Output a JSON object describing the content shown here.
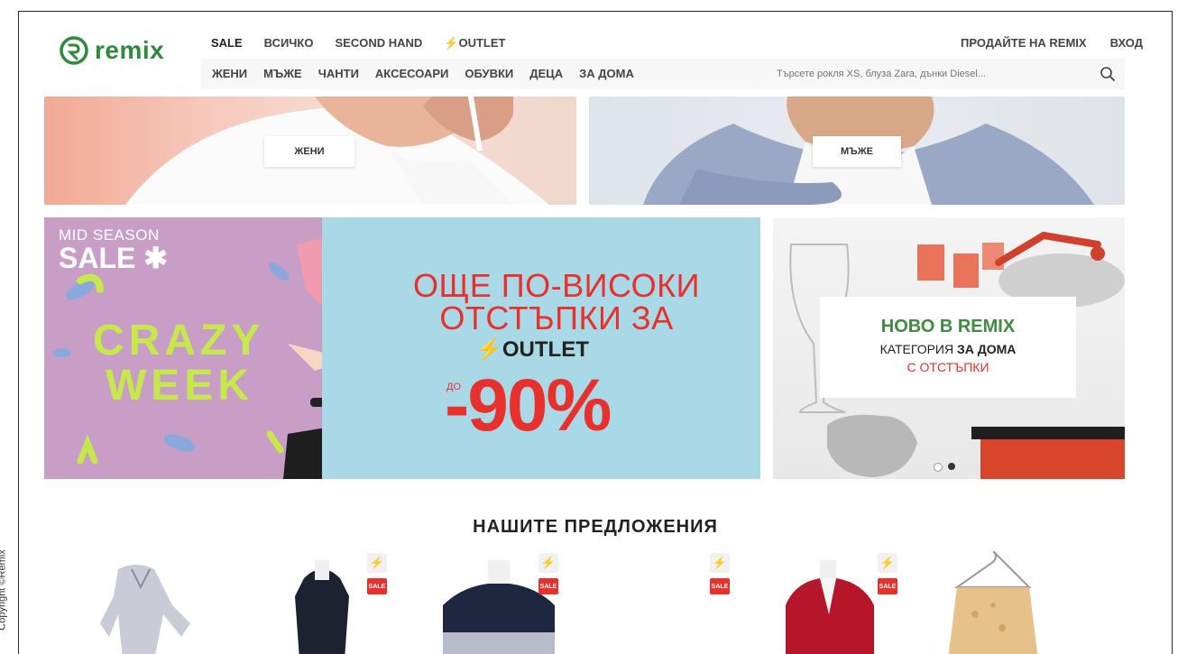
{
  "brand": {
    "logo_text": "remix",
    "accent": "#2f8a3e",
    "sale_color": "#e8312d"
  },
  "copyright": "Copyright ©Remix",
  "top_nav": [
    "SALE",
    "ВСИЧКО",
    "SECOND HAND",
    "⚡OUTLET"
  ],
  "right_nav": {
    "sell": "ПРОДАЙТЕ НА REMIX",
    "login": "ВХОД"
  },
  "category_nav": [
    "ЖЕНИ",
    "МЪЖЕ",
    "ЧАНТИ",
    "АКСЕСОАРИ",
    "ОБУВКИ",
    "ДЕЦА",
    "ЗА ДОМА"
  ],
  "search": {
    "placeholder": "Търсете рокля XS, блуза Zara, дънки Diesel..."
  },
  "banners": {
    "women_label": "ЖЕНИ",
    "men_label": "МЪЖЕ"
  },
  "sale_banner": {
    "mid_season": "MID SEASON",
    "sale": "SALE",
    "crazy": "CRAZY",
    "week": "WEEK",
    "headline_1": "ОЩЕ ПО-ВИСОКИ",
    "headline_2": "ОТСТЪПКИ ЗА",
    "outlet": "⚡OUTLET",
    "do": "ДО",
    "discount": "-90%"
  },
  "home_banner": {
    "title": "НОВО В REMIX",
    "line2_prefix": "КАТЕГОРИЯ ",
    "line2_bold": "ЗА ДОМА",
    "line3": "С ОТСТЪПКИ"
  },
  "offers": {
    "title": "НАШИТЕ ПРЕДЛОЖЕНИЯ",
    "badge_sale": "SALE",
    "badge_flash": "⚡"
  }
}
